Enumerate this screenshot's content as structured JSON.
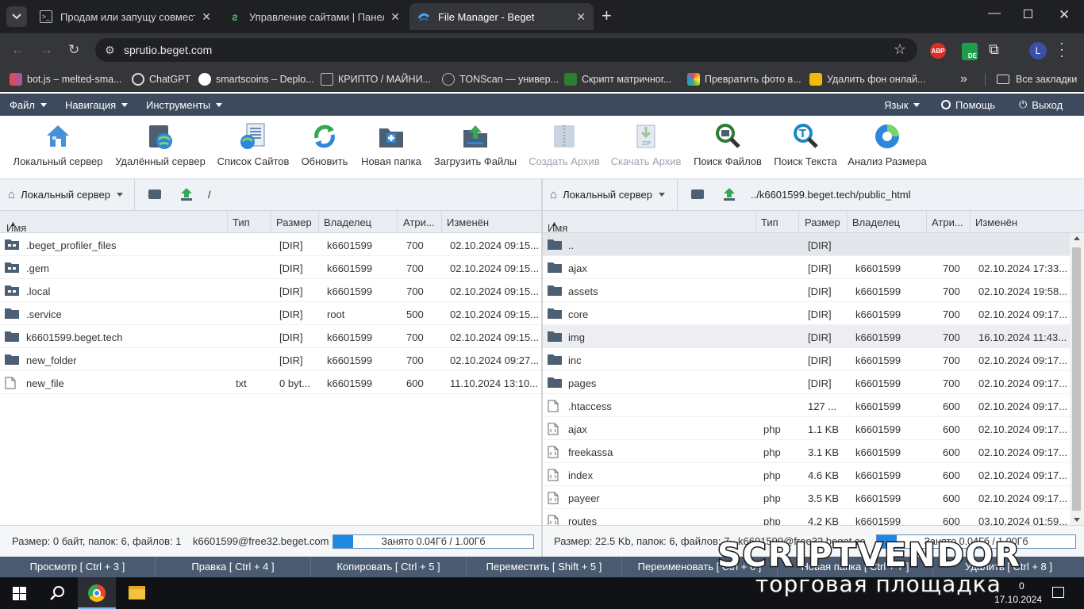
{
  "browser": {
    "tabs": [
      {
        "title": "Продам или запущу совместн",
        "active": false
      },
      {
        "title": "Управление сайтами | Панель",
        "active": false
      },
      {
        "title": "File Manager - Beget",
        "active": true
      }
    ],
    "url": "sprutio.beget.com",
    "extensions": [
      "ABP",
      "DE",
      "L"
    ],
    "bookmarks": [
      {
        "label": "bot.js – melted-sma..."
      },
      {
        "label": "ChatGPT"
      },
      {
        "label": "smartscoins – Deplo..."
      },
      {
        "label": "КРИПТО / МАЙНИ..."
      },
      {
        "label": "TONScan — универ..."
      },
      {
        "label": "Скрипт матричног..."
      },
      {
        "label": "Превратить фото в..."
      },
      {
        "label": "Удалить фон онлай..."
      }
    ],
    "bookmarks_more": "»",
    "all_bookmarks": "Все закладки"
  },
  "menu": {
    "file": "Файл",
    "navigation": "Навигация",
    "tools": "Инструменты",
    "language": "Язык",
    "help": "Помощь",
    "logout": "Выход"
  },
  "toolbar": [
    {
      "label": "Локальный сервер",
      "icon": "home-icon",
      "enabled": true
    },
    {
      "label": "Удалённый сервер",
      "icon": "remote-server-icon",
      "enabled": true
    },
    {
      "label": "Список Сайтов",
      "icon": "site-list-icon",
      "enabled": true
    },
    {
      "label": "Обновить",
      "icon": "refresh-icon",
      "enabled": true
    },
    {
      "label": "Новая папка",
      "icon": "new-folder-icon",
      "enabled": true
    },
    {
      "label": "Загрузить Файлы",
      "icon": "upload-icon",
      "enabled": true
    },
    {
      "label": "Создать Архив",
      "icon": "archive-icon",
      "enabled": false
    },
    {
      "label": "Скачать Архив",
      "icon": "download-archive-icon",
      "enabled": false
    },
    {
      "label": "Поиск Файлов",
      "icon": "search-files-icon",
      "enabled": true
    },
    {
      "label": "Поиск Текста",
      "icon": "search-text-icon",
      "enabled": true
    },
    {
      "label": "Анализ Размера",
      "icon": "size-analysis-icon",
      "enabled": true
    }
  ],
  "columns": {
    "name": "Имя",
    "type": "Тип",
    "size": "Размер",
    "owner": "Владелец",
    "attrs": "Атри...",
    "modified": "Изменён"
  },
  "left": {
    "server": "Локальный сервер",
    "path": "/",
    "rows": [
      {
        "name": ".beget_profiler_files",
        "type": "",
        "size": "[DIR]",
        "owner": "k6601599",
        "attrs": "700",
        "modified": "02.10.2024 09:15...",
        "kind": "dir-link"
      },
      {
        "name": ".gem",
        "type": "",
        "size": "[DIR]",
        "owner": "k6601599",
        "attrs": "700",
        "modified": "02.10.2024 09:15...",
        "kind": "dir-link"
      },
      {
        "name": ".local",
        "type": "",
        "size": "[DIR]",
        "owner": "k6601599",
        "attrs": "700",
        "modified": "02.10.2024 09:15...",
        "kind": "dir-link"
      },
      {
        "name": ".service",
        "type": "",
        "size": "[DIR]",
        "owner": "root",
        "attrs": "500",
        "modified": "02.10.2024 09:15...",
        "kind": "dir"
      },
      {
        "name": "k6601599.beget.tech",
        "type": "",
        "size": "[DIR]",
        "owner": "k6601599",
        "attrs": "700",
        "modified": "02.10.2024 09:15...",
        "kind": "dir"
      },
      {
        "name": "new_folder",
        "type": "",
        "size": "[DIR]",
        "owner": "k6601599",
        "attrs": "700",
        "modified": "02.10.2024 09:27...",
        "kind": "dir"
      },
      {
        "name": "new_file",
        "type": "txt",
        "size": "0 byt...",
        "owner": "k6601599",
        "attrs": "600",
        "modified": "11.10.2024 13:10...",
        "kind": "file"
      }
    ],
    "status": "Размер: 0 байт, папок: 6, файлов: 1",
    "account": "k6601599@free32.beget.com",
    "quota_text": "Занято 0.04Гб / 1.00Гб",
    "quota_fraction": 0.04
  },
  "right": {
    "server": "Локальный сервер",
    "path": "../k6601599.beget.tech/public_html",
    "rows": [
      {
        "name": "..",
        "type": "",
        "size": "[DIR]",
        "owner": "",
        "attrs": "",
        "modified": "",
        "kind": "dir",
        "state": "selected"
      },
      {
        "name": "ajax",
        "type": "",
        "size": "[DIR]",
        "owner": "k6601599",
        "attrs": "700",
        "modified": "02.10.2024 17:33...",
        "kind": "dir"
      },
      {
        "name": "assets",
        "type": "",
        "size": "[DIR]",
        "owner": "k6601599",
        "attrs": "700",
        "modified": "02.10.2024 19:58...",
        "kind": "dir"
      },
      {
        "name": "core",
        "type": "",
        "size": "[DIR]",
        "owner": "k6601599",
        "attrs": "700",
        "modified": "02.10.2024 09:17...",
        "kind": "dir"
      },
      {
        "name": "img",
        "type": "",
        "size": "[DIR]",
        "owner": "k6601599",
        "attrs": "700",
        "modified": "16.10.2024 11:43...",
        "kind": "dir",
        "state": "hover"
      },
      {
        "name": "inc",
        "type": "",
        "size": "[DIR]",
        "owner": "k6601599",
        "attrs": "700",
        "modified": "02.10.2024 09:17...",
        "kind": "dir"
      },
      {
        "name": "pages",
        "type": "",
        "size": "[DIR]",
        "owner": "k6601599",
        "attrs": "700",
        "modified": "02.10.2024 09:17...",
        "kind": "dir"
      },
      {
        "name": ".htaccess",
        "type": "",
        "size": "127 ...",
        "owner": "k6601599",
        "attrs": "600",
        "modified": "02.10.2024 09:17...",
        "kind": "file"
      },
      {
        "name": "ajax",
        "type": "php",
        "size": "1.1 KB",
        "owner": "k6601599",
        "attrs": "600",
        "modified": "02.10.2024 09:17...",
        "kind": "code"
      },
      {
        "name": "freekassa",
        "type": "php",
        "size": "3.1 KB",
        "owner": "k6601599",
        "attrs": "600",
        "modified": "02.10.2024 09:17...",
        "kind": "code"
      },
      {
        "name": "index",
        "type": "php",
        "size": "4.6 KB",
        "owner": "k6601599",
        "attrs": "600",
        "modified": "02.10.2024 09:17...",
        "kind": "code"
      },
      {
        "name": "payeer",
        "type": "php",
        "size": "3.5 KB",
        "owner": "k6601599",
        "attrs": "600",
        "modified": "02.10.2024 09:17...",
        "kind": "code"
      },
      {
        "name": "routes",
        "type": "php",
        "size": "4.2 KB",
        "owner": "k6601599",
        "attrs": "600",
        "modified": "03.10.2024 01:59...",
        "kind": "code"
      }
    ],
    "status": "Размер: 22.5 Kb, папок: 6, файлов: 7",
    "account": "k6601599@free32.beget.com",
    "quota_text": "Занято 0.04Гб / 1.00Гб",
    "quota_fraction": 0.04
  },
  "fkeys": [
    "Просмотр [ Ctrl + 3 ]",
    "Правка [ Ctrl + 4 ]",
    "Копировать [ Ctrl + 5 ]",
    "Переместить [ Shift + 5 ]",
    "Переименовать [ Ctrl + 6 ]",
    "Новая папка [ Ctrl + 7 ]",
    "Удалить [ Ctrl + 8 ]"
  ],
  "taskbar": {
    "time": "0",
    "date": "17.10.2024"
  },
  "watermark": {
    "line1": "SCRIPTVENDOR",
    "line2": "торговая площадка"
  },
  "colors": {
    "menu_bg": "#3d4a5d",
    "fkeys_bg": "#4a5a70",
    "quota_fill": "#1e88e5",
    "selected_row": "#e3e6ea"
  }
}
